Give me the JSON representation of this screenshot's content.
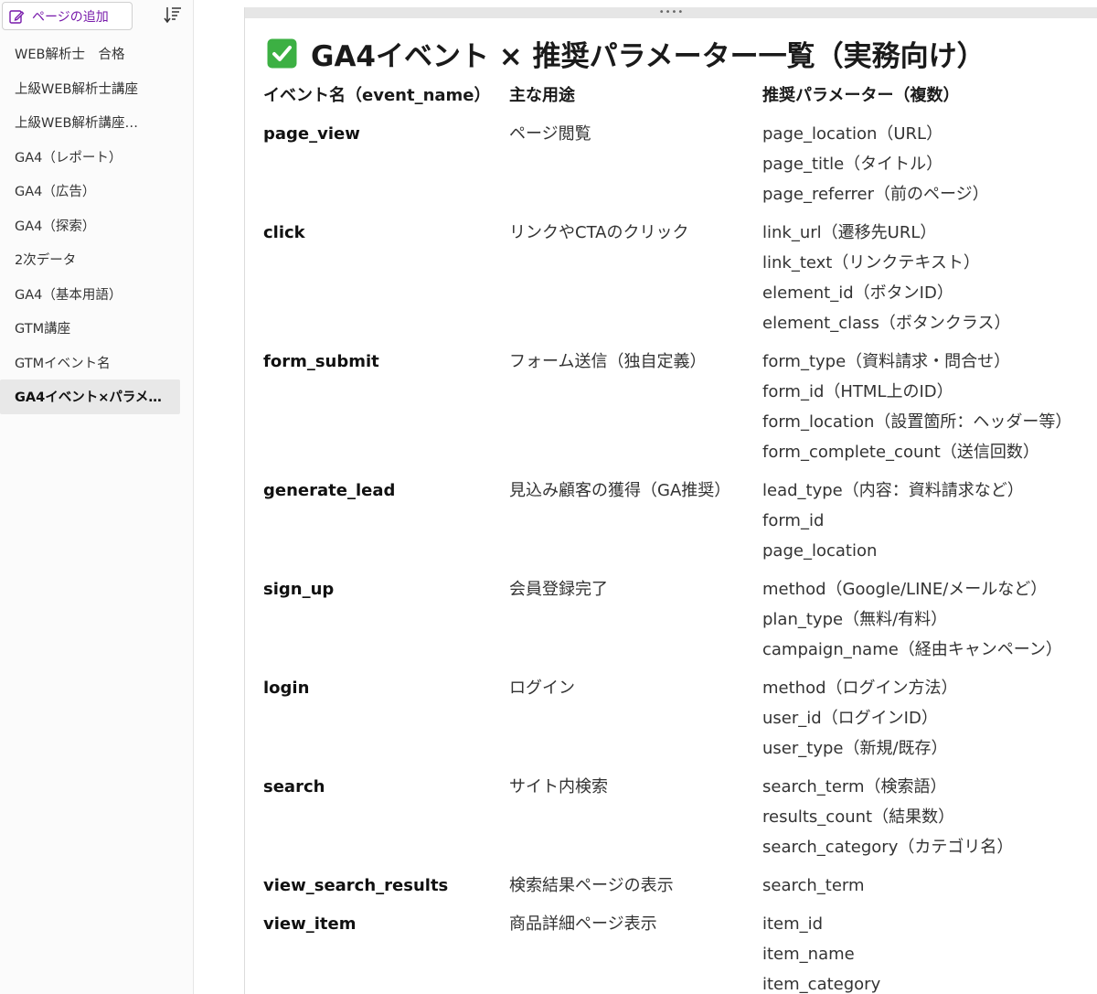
{
  "sidebar": {
    "add_page_label": "ページの追加",
    "pages": [
      "WEB解析士　合格",
      "上級WEB解析士講座",
      "上級WEB解析講座…",
      "GA4（レポート）",
      "GA4（広告）",
      "GA4（探索）",
      "2次データ",
      "GA4（基本用語）",
      "GTM講座",
      "GTMイベント名",
      "GA4イベント×パラメ…"
    ],
    "active_index": 10
  },
  "page": {
    "title": "GA4イベント × 推奨パラメーター一覧（実務向け）",
    "title_icon": "check-mark-button-icon"
  },
  "table": {
    "headers": [
      "イベント名（event_name）",
      "主な用途",
      "推奨パラメーター（複数）"
    ],
    "rows": [
      {
        "event": "page_view",
        "use": "ページ閲覧",
        "params": [
          "page_location（URL）",
          "page_title（タイトル）",
          "page_referrer（前のページ）"
        ]
      },
      {
        "event": "click",
        "use": "リンクやCTAのクリック",
        "params": [
          "link_url（遷移先URL）",
          "link_text（リンクテキスト）",
          "element_id（ボタンID）",
          "element_class（ボタンクラス）"
        ]
      },
      {
        "event": "form_submit",
        "use": "フォーム送信（独自定義）",
        "params": [
          "form_type（資料請求・問合せ）",
          "form_id（HTML上のID）",
          "form_location（設置箇所：ヘッダー等）",
          "form_complete_count（送信回数）"
        ]
      },
      {
        "event": "generate_lead",
        "use": "見込み顧客の獲得（GA推奨）",
        "params": [
          "lead_type（内容：資料請求など）",
          "form_id",
          "page_location"
        ]
      },
      {
        "event": "sign_up",
        "use": "会員登録完了",
        "params": [
          "method（Google/LINE/メールなど）",
          "plan_type（無料/有料）",
          "campaign_name（経由キャンペーン）"
        ]
      },
      {
        "event": "login",
        "use": "ログイン",
        "params": [
          "method（ログイン方法）",
          "user_id（ログインID）",
          "user_type（新規/既存）"
        ]
      },
      {
        "event": "search",
        "use": "サイト内検索",
        "params": [
          "search_term（検索語）",
          "results_count（結果数）",
          "search_category（カテゴリ名）"
        ]
      },
      {
        "event": "view_search_results",
        "use": "検索結果ページの表示",
        "params": [
          "search_term"
        ]
      },
      {
        "event": "view_item",
        "use": "商品詳細ページ表示",
        "params": [
          "item_id",
          "item_name",
          "item_category"
        ]
      }
    ]
  },
  "colors": {
    "accent": "#7719aa",
    "check_green": "#3cb043"
  }
}
